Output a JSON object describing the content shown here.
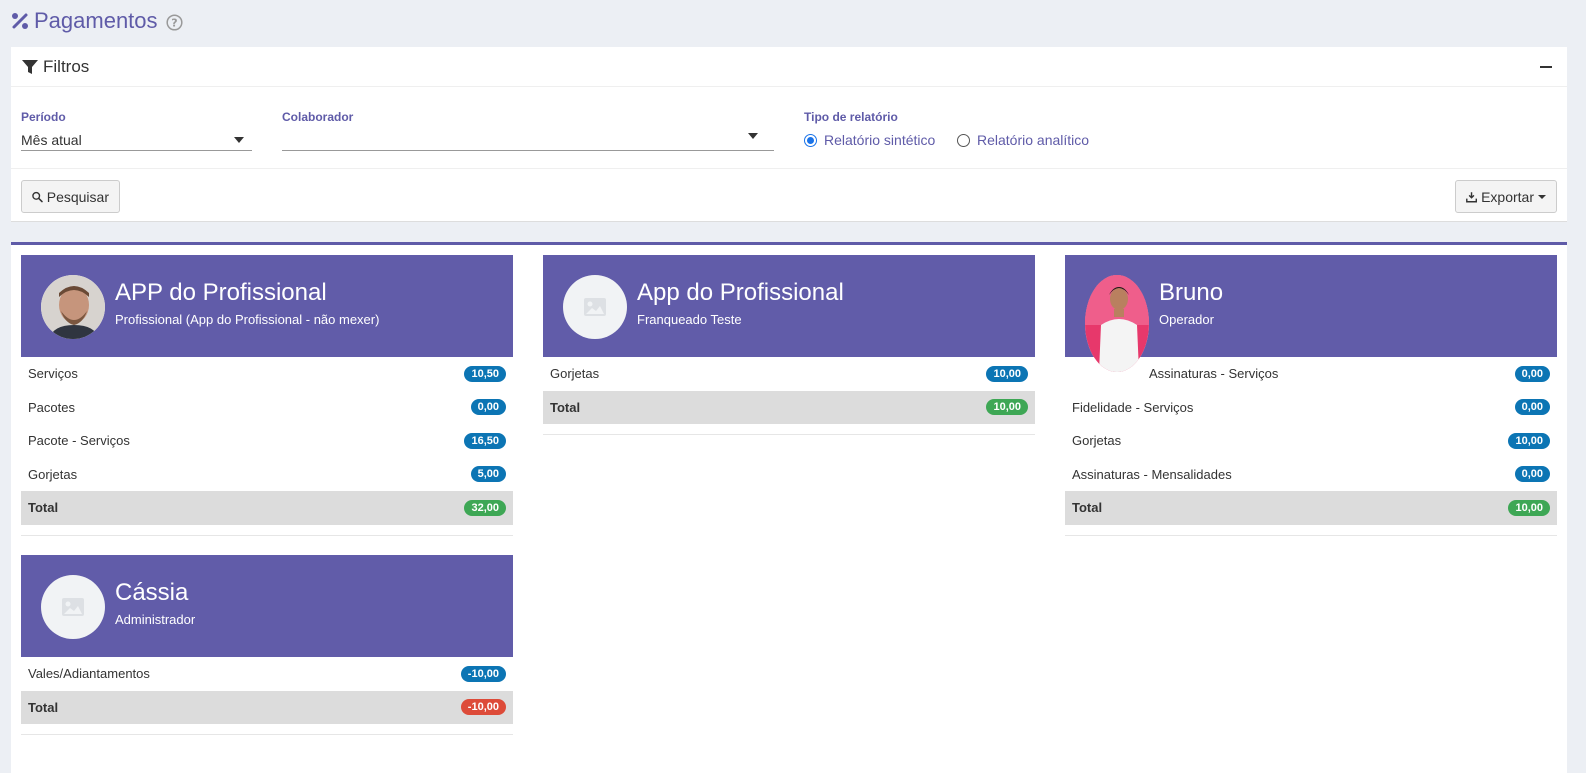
{
  "page": {
    "title": "Pagamentos",
    "title_icon": "percent-icon",
    "help_icon": "help-circle-icon"
  },
  "filters": {
    "title": "Filtros",
    "periodo": {
      "label": "Período",
      "value": "Mês atual"
    },
    "colaborador": {
      "label": "Colaborador",
      "value": ""
    },
    "tipo": {
      "label": "Tipo de relatório",
      "options": [
        "Relatório sintético",
        "Relatório analítico"
      ],
      "selected": "Relatório sintético"
    },
    "search_label": "Pesquisar",
    "export_label": "Exportar"
  },
  "colors": {
    "accent": "#615ca9",
    "badge_blue": "#0c75b4",
    "badge_green": "#3ea755",
    "badge_red": "#dd4b39"
  },
  "cards": [
    {
      "name": "APP do Profissional",
      "role": "Profissional (App do Profissional - não mexer)",
      "avatar": "photo",
      "rows": [
        {
          "label": "Serviços",
          "value": "10,50"
        },
        {
          "label": "Pacotes",
          "value": "0,00"
        },
        {
          "label": "Pacote - Serviços",
          "value": "16,50"
        },
        {
          "label": "Gorjetas",
          "value": "5,00"
        }
      ],
      "total_label": "Total",
      "total": "32,00",
      "total_status": "green"
    },
    {
      "name": "App do Profissional",
      "role": "Franqueado Teste",
      "avatar": "placeholder-image-icon",
      "rows": [
        {
          "label": "Gorjetas",
          "value": "10,00"
        }
      ],
      "total_label": "Total",
      "total": "10,00",
      "total_status": "green"
    },
    {
      "name": "Bruno",
      "role": "Operador",
      "avatar": "photo",
      "rows": [
        {
          "label": "Assinaturas - Serviços",
          "value": "0,00"
        },
        {
          "label": "Fidelidade - Serviços",
          "value": "0,00"
        },
        {
          "label": "Gorjetas",
          "value": "10,00"
        },
        {
          "label": "Assinaturas - Mensalidades",
          "value": "0,00"
        }
      ],
      "total_label": "Total",
      "total": "10,00",
      "total_status": "green"
    },
    {
      "name": "Cássia",
      "role": "Administrador",
      "avatar": "placeholder-image-icon",
      "rows": [
        {
          "label": "Vales/Adiantamentos",
          "value": "-10,00"
        }
      ],
      "total_label": "Total",
      "total": "-10,00",
      "total_status": "red"
    }
  ]
}
